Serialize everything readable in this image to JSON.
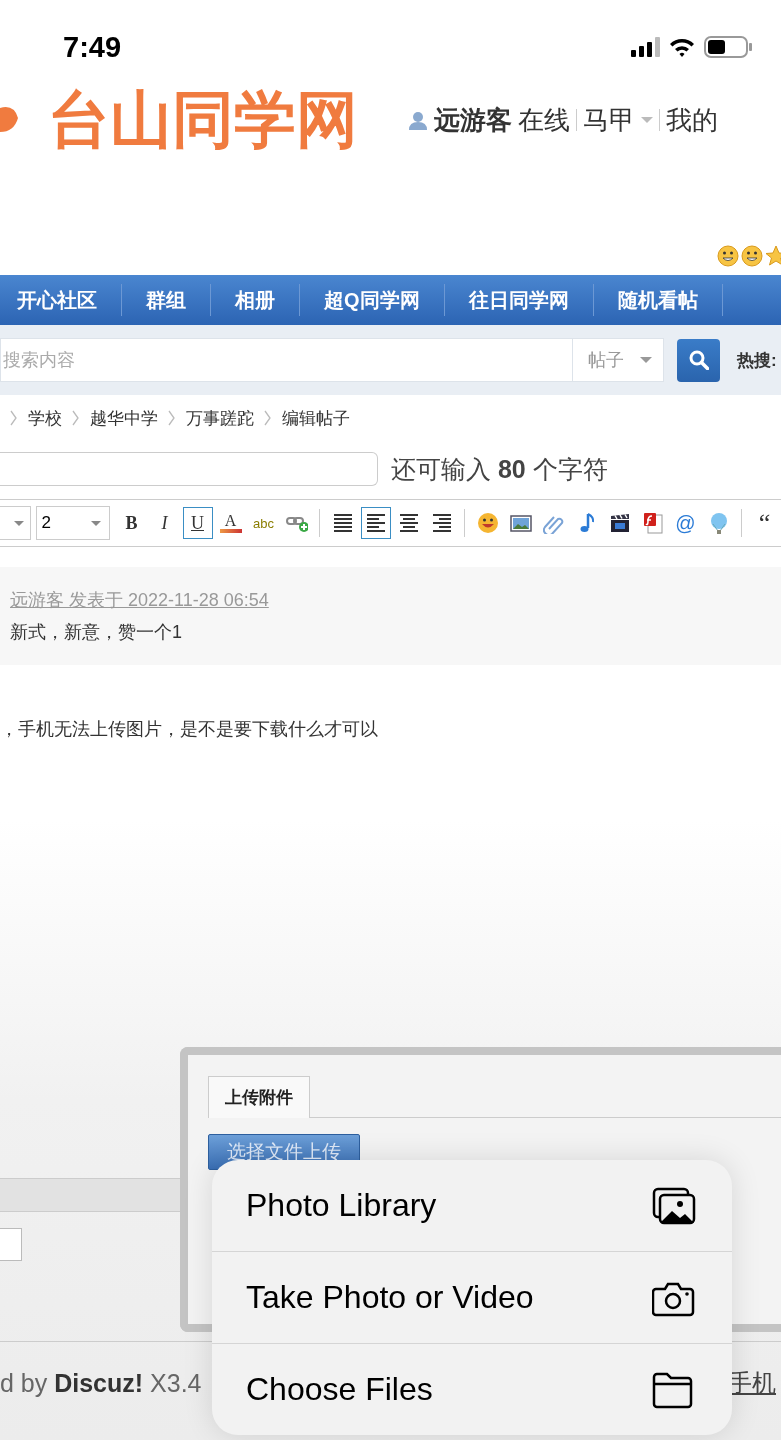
{
  "status_bar": {
    "time": "7:49"
  },
  "header": {
    "logo": "台山同学网",
    "user": "远游客",
    "status": "在线",
    "links": [
      {
        "label": "马甲",
        "dropdown": true
      },
      {
        "label": "我的",
        "dropdown": false
      }
    ]
  },
  "nav": {
    "items": [
      {
        "label": "开心社区"
      },
      {
        "label": "群组"
      },
      {
        "label": "相册"
      },
      {
        "label": "超Q同学网"
      },
      {
        "label": "往日同学网"
      },
      {
        "label": "随机看帖"
      }
    ]
  },
  "search": {
    "placeholder": "搜索内容",
    "scope": "帖子",
    "hot_label": "热搜:"
  },
  "breadcrumb": [
    "学校",
    "越华中学",
    "万事蹉跎",
    "编辑帖子"
  ],
  "title_field": {
    "hint": "还可输入 **80** 个字符"
  },
  "toolbar": {
    "font_size": "2",
    "groups": [
      [
        {
          "kind": "bold",
          "label": "B",
          "selected": false
        },
        {
          "kind": "italic",
          "label": "I",
          "selected": false
        },
        {
          "kind": "underline",
          "label": "U",
          "selected": true
        },
        {
          "kind": "color",
          "label": "A"
        },
        {
          "kind": "spell",
          "label": "abc"
        },
        {
          "kind": "link"
        }
      ],
      [
        {
          "kind": "justify",
          "selected": false
        },
        {
          "kind": "align-left",
          "selected": true
        },
        {
          "kind": "align-center",
          "selected": false
        },
        {
          "kind": "align-right",
          "selected": false
        }
      ],
      [
        {
          "kind": "smiley"
        },
        {
          "kind": "image"
        },
        {
          "kind": "attach"
        },
        {
          "kind": "music"
        },
        {
          "kind": "video"
        },
        {
          "kind": "flash"
        },
        {
          "kind": "mention",
          "label": "@"
        },
        {
          "kind": "balloon"
        }
      ],
      [
        {
          "kind": "quote",
          "label": "“"
        }
      ]
    ]
  },
  "quote": {
    "author_line": "远游客 发表于 2022-11-28 06:54",
    "text": "新式，新意，赞一个1"
  },
  "body": "，手机无法上传图片，是不是要下载什么才可以",
  "upload_dialog": {
    "tab": "上传附件",
    "button": "选择文件上传"
  },
  "footer": {
    "powered": "d by **Discuz!** X3.4",
    "link": "手机"
  },
  "action_menu": {
    "items": [
      {
        "kind": "photos",
        "label": "Photo Library"
      },
      {
        "kind": "camera",
        "label": "Take Photo or Video"
      },
      {
        "kind": "folder",
        "label": "Choose Files"
      }
    ]
  }
}
